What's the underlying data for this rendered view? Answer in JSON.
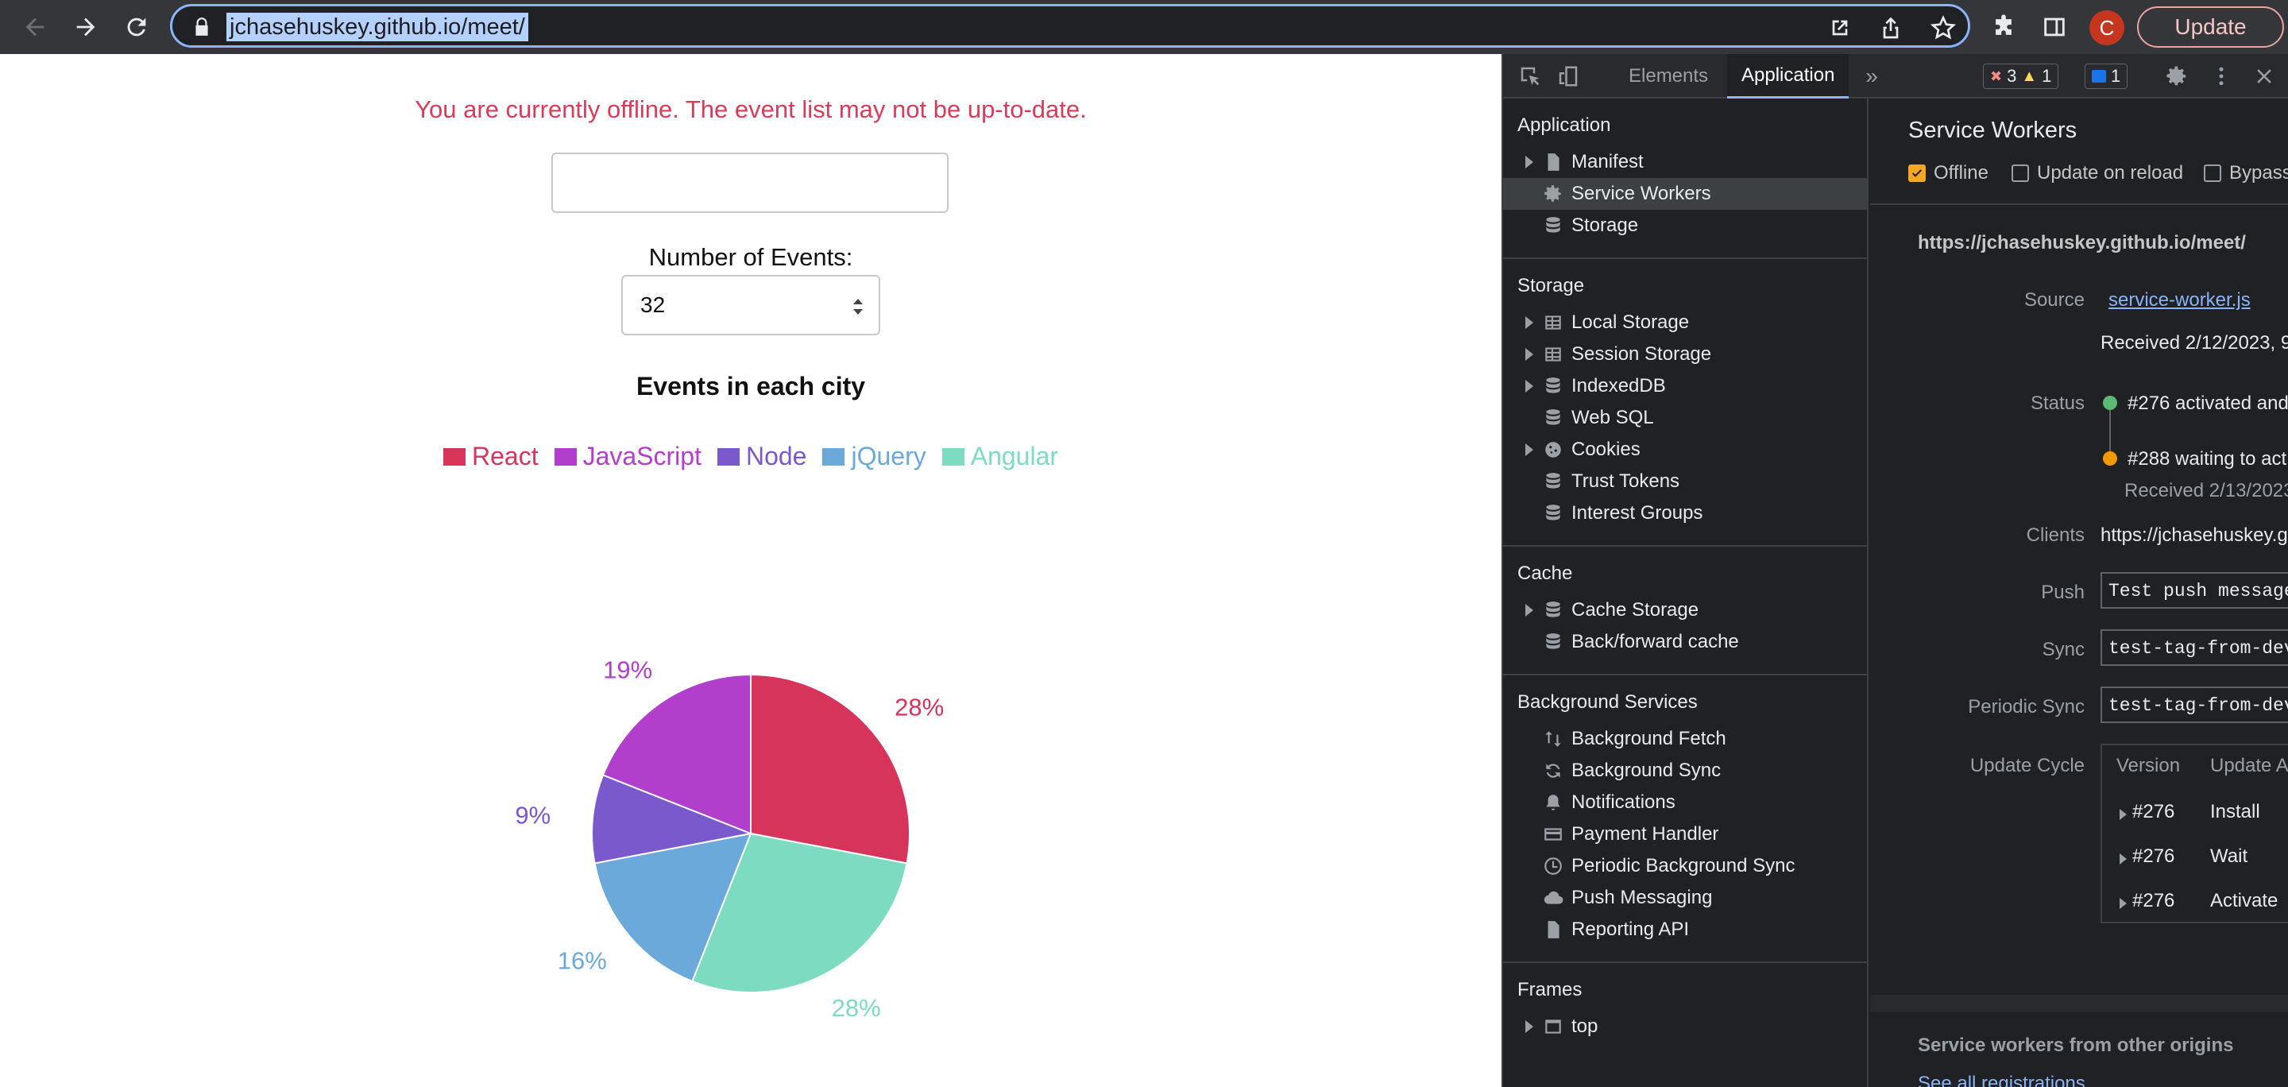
{
  "browser": {
    "url": "jchasehuskey.github.io/meet/",
    "avatar_letter": "C",
    "update_label": "Update"
  },
  "app": {
    "offline_message": "You are currently offline. The event list may not be up-to-date.",
    "city_input_value": "",
    "number_of_events_label": "Number of Events:",
    "number_of_events_value": "32"
  },
  "chart_data": {
    "type": "pie",
    "title": "Events in each city",
    "legend": [
      "React",
      "JavaScript",
      "Node",
      "jQuery",
      "Angular"
    ],
    "colors": [
      "#d6345b",
      "#b13fcb",
      "#7a59cc",
      "#6ba9db",
      "#7ddbc1"
    ],
    "values": [
      28,
      19,
      9,
      16,
      28
    ],
    "value_labels": [
      "28%",
      "19%",
      "9%",
      "16%",
      "28%"
    ]
  },
  "devtools": {
    "tabs": [
      "Elements",
      "Application"
    ],
    "active_tab": "Application",
    "errors": "3",
    "warnings": "1",
    "messages": "1",
    "sidebar": {
      "application_header": "Application",
      "application_items": [
        "Manifest",
        "Service Workers",
        "Storage"
      ],
      "storage_header": "Storage",
      "storage_items": [
        "Local Storage",
        "Session Storage",
        "IndexedDB",
        "Web SQL",
        "Cookies",
        "Trust Tokens",
        "Interest Groups"
      ],
      "cache_header": "Cache",
      "cache_items": [
        "Cache Storage",
        "Back/forward cache"
      ],
      "bg_header": "Background Services",
      "bg_items": [
        "Background Fetch",
        "Background Sync",
        "Notifications",
        "Payment Handler",
        "Periodic Background Sync",
        "Push Messaging",
        "Reporting API"
      ],
      "frames_header": "Frames",
      "frames_items": [
        "top"
      ]
    },
    "service_workers": {
      "title": "Service Workers",
      "offline_label": "Offline",
      "offline_checked": true,
      "update_on_reload_label": "Update on reload",
      "bypass_label": "Bypass",
      "origin": "https://jchasehuskey.github.io/meet/",
      "source_key": "Source",
      "source_link": "service-worker.js",
      "received": "Received 2/12/2023, 9",
      "status_key": "Status",
      "status_active": "#276 activated and",
      "status_waiting": "#288 waiting to act",
      "status_waiting_received": "Received 2/13/2023",
      "clients_key": "Clients",
      "clients_value": "https://jchasehuskey.g",
      "push_key": "Push",
      "push_value": "Test push message",
      "sync_key": "Sync",
      "sync_value": "test-tag-from-dev",
      "periodic_sync_key": "Periodic Sync",
      "periodic_sync_value": "test-tag-from-dev",
      "update_cycle_key": "Update Cycle",
      "update_cycle_headers": [
        "Version",
        "Update A"
      ],
      "update_cycle_rows": [
        {
          "version": "#276",
          "activity": "Install"
        },
        {
          "version": "#276",
          "activity": "Wait"
        },
        {
          "version": "#276",
          "activity": "Activate"
        }
      ],
      "other_origins": "Service workers from other origins",
      "see_all": "See all registrations"
    }
  }
}
